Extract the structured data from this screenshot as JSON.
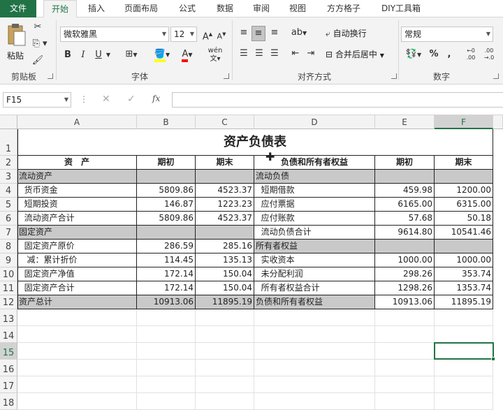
{
  "tabs": [
    "文件",
    "开始",
    "插入",
    "页面布局",
    "公式",
    "数据",
    "审阅",
    "视图",
    "方方格子",
    "DIY工具箱"
  ],
  "ribbon": {
    "clipboard": {
      "paste": "粘贴",
      "label": "剪贴板"
    },
    "font": {
      "name": "微软雅黑",
      "size": "12",
      "label": "字体",
      "bold": "B",
      "italic": "I",
      "underline": "U",
      "phonetic": "wén"
    },
    "align": {
      "wrap": "自动换行",
      "merge": "合并后居中",
      "label": "对齐方式"
    },
    "number": {
      "format": "常规",
      "percent": "%",
      "comma": ",",
      "label": "数字"
    }
  },
  "formula_bar": {
    "name_box": "F15",
    "fx": "fx",
    "formula": ""
  },
  "colors": {
    "accent": "#217346",
    "gray_fill": "#c9c9c9",
    "selected": "#217346"
  },
  "columns": [
    "A",
    "B",
    "C",
    "D",
    "E",
    "F"
  ],
  "rows": [
    "1",
    "2",
    "3",
    "4",
    "5",
    "6",
    "7",
    "8",
    "9",
    "10",
    "11",
    "12",
    "13",
    "14",
    "15",
    "16",
    "17",
    "18"
  ],
  "sheet": {
    "title": "资产负债表",
    "headers": [
      "资　产",
      "期初",
      "期末",
      "负债和所有者权益",
      "期初",
      "期末"
    ],
    "data": [
      [
        "流动资产",
        "",
        "",
        "流动负债",
        "",
        ""
      ],
      [
        "  货币资金",
        "5809.86",
        "4523.37",
        "  短期借款",
        "459.98",
        "1200.00"
      ],
      [
        "  短期投资",
        "146.87",
        "1223.23",
        "  应付票据",
        "6165.00",
        "6315.00"
      ],
      [
        "  流动资产合计",
        "5809.86",
        "4523.37",
        "  应付账款",
        "57.68",
        "50.18"
      ],
      [
        "固定资产",
        "",
        "",
        "  流动负债合计",
        "9614.80",
        "10541.46"
      ],
      [
        "  固定资产原价",
        "286.59",
        "285.16",
        "所有者权益",
        "",
        ""
      ],
      [
        "   减：累计折价",
        "114.45",
        "135.13",
        "  实收资本",
        "1000.00",
        "1000.00"
      ],
      [
        "  固定资产净值",
        "172.14",
        "150.04",
        "  未分配利润",
        "298.26",
        "353.74"
      ],
      [
        "  固定资产合计",
        "172.14",
        "150.04",
        "  所有者权益合计",
        "1298.26",
        "1353.74"
      ],
      [
        "资产总计",
        "10913.06",
        "11895.19",
        "负债和所有者权益",
        "10913.06",
        "11895.19"
      ]
    ]
  }
}
